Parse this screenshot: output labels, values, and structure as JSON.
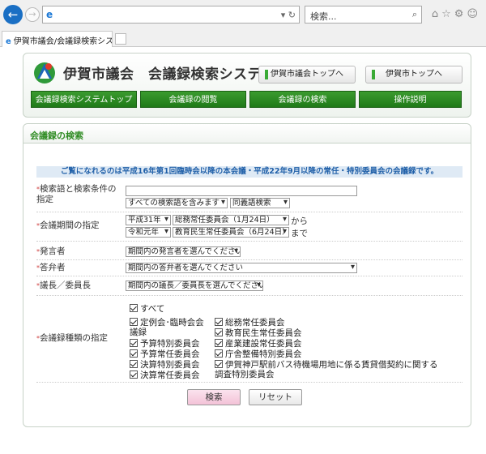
{
  "browser": {
    "search_placeholder": "検索...",
    "tab_title": "伊賀市議会/会議録検索シス...",
    "address_icon": "e"
  },
  "header": {
    "title": "伊賀市議会　会議録検索システム",
    "links": [
      "伊賀市議会トップへ",
      "伊賀市トップへ"
    ],
    "nav": [
      "会議録検索システムトップ",
      "会議録の閲覧",
      "会議録の検索",
      "操作説明"
    ]
  },
  "section": {
    "title": "会議録の検索",
    "notice": "ご覧になれるのは平成16年第1回臨時会以降の本会議・平成22年9月以降の常任・特別委員会の会議録です。"
  },
  "form": {
    "keyword_label_1": "検索語と検索条件の",
    "keyword_label_2": "指定",
    "keyword_value": "",
    "keyword_mode": "すべての検索語を含みます",
    "synonym_mode": "同義語検索",
    "period_label": "会議期間の指定",
    "period_from_era": "平成31年",
    "period_from_meeting": "総務常任委員会（1月24日）",
    "period_from_suffix": "から",
    "period_to_era": "令和元年",
    "period_to_meeting": "教育民生常任委員会（6月24日）",
    "period_to_suffix": "まで",
    "speaker_label": "発言者",
    "speaker_value": "期間内の発言者を選んでください",
    "answerer_label": "答弁者",
    "answerer_value": "期間内の答弁者を選んでください",
    "chair_label": "議長／委員長",
    "chair_value": "期間内の議長／委員長を選んでください",
    "type_label": "会議録種類の指定",
    "type_all": "すべて",
    "types_left": [
      "定例会･臨時会会議録",
      "予算特別委員会",
      "予算常任委員会",
      "決算特別委員会",
      "決算常任委員会"
    ],
    "types_right": [
      "総務常任委員会",
      "教育民生常任委員会",
      "産業建設常任委員会",
      "庁舎整備特別委員会",
      "伊賀神戸駅前バス待機場用地に係る賃貸借契約に関する調査特別委員会"
    ],
    "search_button": "検索",
    "reset_button": "リセット"
  },
  "colors": {
    "nav_green": "#2a8a22",
    "section_title": "#2e8b22",
    "notice_bg": "#dfeaf5",
    "notice_text": "#1f5fa8",
    "search_btn": "#f6cfe0"
  }
}
